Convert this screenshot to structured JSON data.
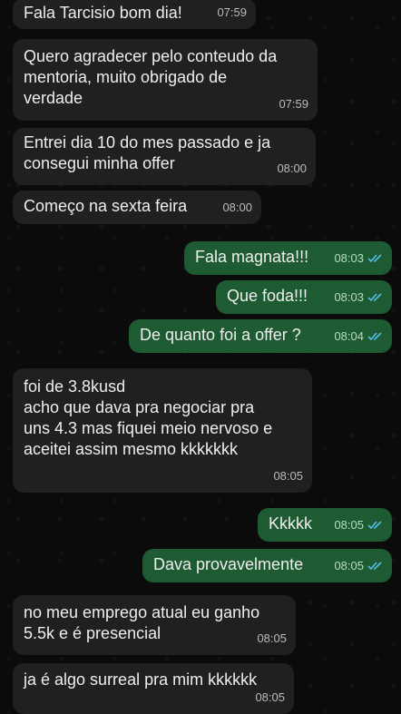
{
  "messages": [
    {
      "dir": "in",
      "text": "Fala Tarcisio bom dia!",
      "time": "07:59"
    },
    {
      "dir": "in",
      "text": "Quero agradecer pelo conteudo da\nmentoria, muito obrigado de\nverdade",
      "time": "07:59"
    },
    {
      "dir": "in",
      "text": "Entrei dia 10 do mes passado e ja\nconsegui minha offer",
      "time": "08:00"
    },
    {
      "dir": "in",
      "text": "Começo na sexta feira",
      "time": "08:00"
    },
    {
      "dir": "out",
      "text": "Fala magnata!!!",
      "time": "08:03",
      "status": "read"
    },
    {
      "dir": "out",
      "text": "Que foda!!!",
      "time": "08:03",
      "status": "read"
    },
    {
      "dir": "out",
      "text": "De quanto foi a offer ?",
      "time": "08:04",
      "status": "read"
    },
    {
      "dir": "in",
      "text": "foi de 3.8kusd\nacho que dava pra negociar pra\nuns 4.3 mas fiquei meio nervoso e\naceitei assim mesmo kkkkkkk",
      "time": "08:05"
    },
    {
      "dir": "out",
      "text": "Kkkkk",
      "time": "08:05",
      "status": "read"
    },
    {
      "dir": "out",
      "text": "Dava provavelmente",
      "time": "08:05",
      "status": "read"
    },
    {
      "dir": "in",
      "text": "no meu emprego atual eu ganho\n5.5k e é presencial",
      "time": "08:05"
    },
    {
      "dir": "in",
      "text": "ja é algo surreal pra mim kkkkkk",
      "time": "08:05"
    }
  ],
  "colors": {
    "incoming_bubble": "#202020",
    "outgoing_bubble": "#1e5b33",
    "read_ticks": "#53bdeb",
    "background": "#0b0b0b"
  },
  "icons": {
    "read_status": "double-check-icon"
  }
}
